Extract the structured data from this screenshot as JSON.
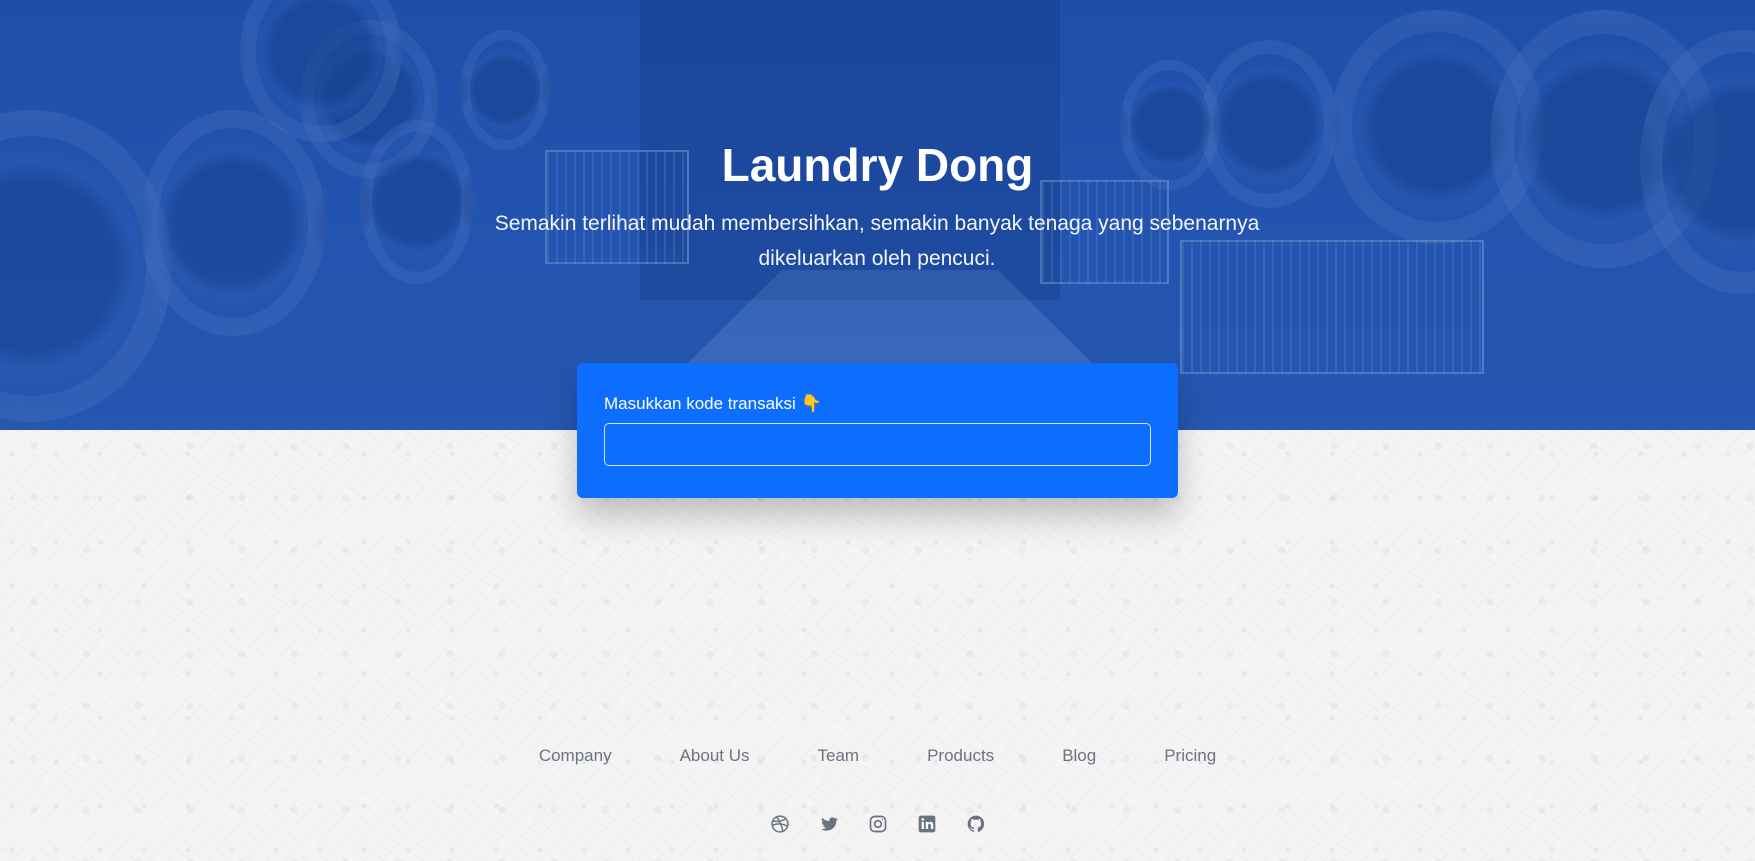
{
  "hero": {
    "title": "Laundry Dong",
    "subtitle": "Semakin terlihat mudah membersihkan, semakin banyak tenaga yang sebenarnya dikeluarkan oleh pencuci."
  },
  "transaction": {
    "label": "Masukkan kode transaksi 👇",
    "input_value": "",
    "input_placeholder": ""
  },
  "footer": {
    "links": [
      "Company",
      "About Us",
      "Team",
      "Products",
      "Blog",
      "Pricing"
    ],
    "social_icons": [
      "dribbble-icon",
      "twitter-icon",
      "instagram-icon",
      "linkedin-icon",
      "github-icon"
    ]
  },
  "colors": {
    "primary": "#0d6efd",
    "hero_overlay": "#1d4eaa",
    "footer_text": "#6b7280"
  }
}
